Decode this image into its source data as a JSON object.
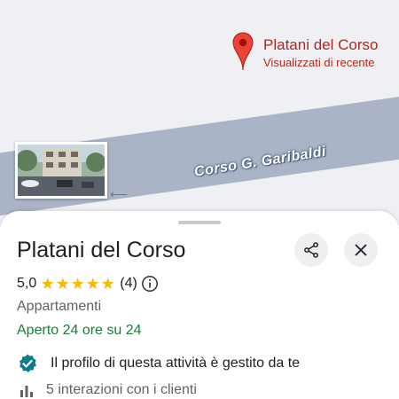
{
  "map": {
    "street_label": "Corso G. Garibaldi",
    "marker": {
      "name": "Platani del Corso",
      "subtitle": "Visualizzati di recente",
      "color": "#ea4335"
    }
  },
  "sheet": {
    "title": "Platani del Corso",
    "rating": "5,0",
    "stars": "★★★★★",
    "star_count": 5,
    "review_count": "(4)",
    "category": "Appartamenti",
    "hours": "Aperto 24 ore su 24",
    "verified_text": "Il profilo di questa attività è gestito da te",
    "interactions_text": "5 interazioni con i clienti"
  },
  "icons": {
    "share": "share-icon",
    "close": "close-icon",
    "info": "info-icon",
    "verified": "verified-badge-icon",
    "bar_chart": "bar-chart-icon",
    "pin": "map-pin-icon"
  },
  "colors": {
    "star": "#f9b808",
    "open": "#188038",
    "verified": "#0f7b8a",
    "marker_text": "#b3261e"
  }
}
